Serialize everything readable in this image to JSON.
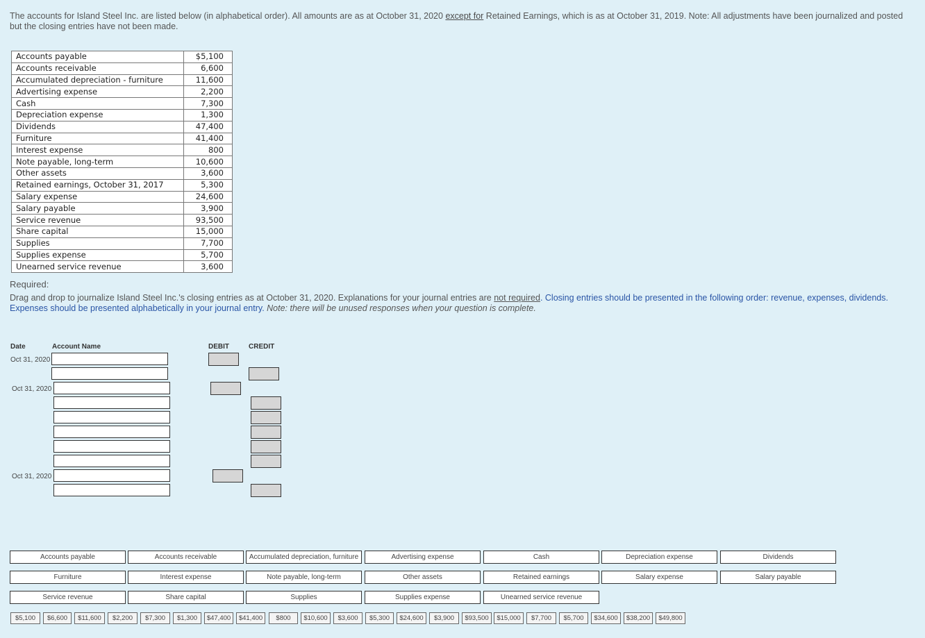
{
  "intro": {
    "part1": "The accounts for Island Steel Inc. are listed below (in alphabetical order).  All amounts are as at October 31, 2020 ",
    "part2": "except for",
    "part3": " Retained Earnings, which is as at October 31, 2019. Note:  All adjustments have been journalized and posted but the closing entries have not been made."
  },
  "accounts": [
    {
      "name": "Accounts payable",
      "amount": "$5,100"
    },
    {
      "name": "Accounts receivable",
      "amount": "6,600"
    },
    {
      "name": "Accumulated depreciation - furniture",
      "amount": "11,600"
    },
    {
      "name": "Advertising expense",
      "amount": "2,200"
    },
    {
      "name": "Cash",
      "amount": "7,300"
    },
    {
      "name": "Depreciation expense",
      "amount": "1,300"
    },
    {
      "name": "Dividends",
      "amount": "47,400"
    },
    {
      "name": "Furniture",
      "amount": "41,400"
    },
    {
      "name": "Interest expense",
      "amount": "800"
    },
    {
      "name": "Note payable, long-term",
      "amount": "10,600"
    },
    {
      "name": "Other assets",
      "amount": "3,600"
    },
    {
      "name": "Retained earnings, October 31, 2017",
      "amount": "5,300"
    },
    {
      "name": "Salary expense",
      "amount": "24,600"
    },
    {
      "name": "Salary payable",
      "amount": "3,900"
    },
    {
      "name": "Service revenue",
      "amount": "93,500"
    },
    {
      "name": "Share capital",
      "amount": "15,000"
    },
    {
      "name": "Supplies",
      "amount": "7,700"
    },
    {
      "name": "Supplies expense",
      "amount": "5,700"
    },
    {
      "name": "Unearned service revenue",
      "amount": "3,600"
    }
  ],
  "required": {
    "heading": "Required:",
    "i1": "Drag and drop to journalize Island Steel Inc.'s closing entries as at October 31, 2020. Explanations for your journal entries are ",
    "i2": "not required",
    "i3": ".  Closing entries should be presented in the following order: revenue, expenses, dividends.  Expenses should be presented alphabetically in your journal entry.  ",
    "note": "Note: there will be unused responses when your question is complete."
  },
  "journal": {
    "date_header": "Date",
    "account_header": "Account Name",
    "debit_header": "DEBIT",
    "credit_header": "CREDIT",
    "entry_date": "Oct 31, 2020"
  },
  "account_options": [
    "Accounts payable",
    "Accounts receivable",
    "Accumulated depreciation, furniture",
    "Advertising expense",
    "Cash",
    "Depreciation expense",
    "Dividends",
    "Furniture",
    "Interest expense",
    "Note payable, long-term",
    "Other assets",
    "Retained earnings",
    "Salary expense",
    "Salary payable",
    "Service revenue",
    "Share capital",
    "Supplies",
    "Supplies expense",
    "Unearned service revenue"
  ],
  "amount_options": [
    "$5,100",
    "$6,600",
    "$11,600",
    "$2,200",
    "$7,300",
    "$1,300",
    "$47,400",
    "$41,400",
    "$800",
    "$10,600",
    "$3,600",
    "$5,300",
    "$24,600",
    "$3,900",
    "$93,500",
    "$15,000",
    "$7,700",
    "$5,700",
    "$34,600",
    "$38,200",
    "$49,800"
  ]
}
